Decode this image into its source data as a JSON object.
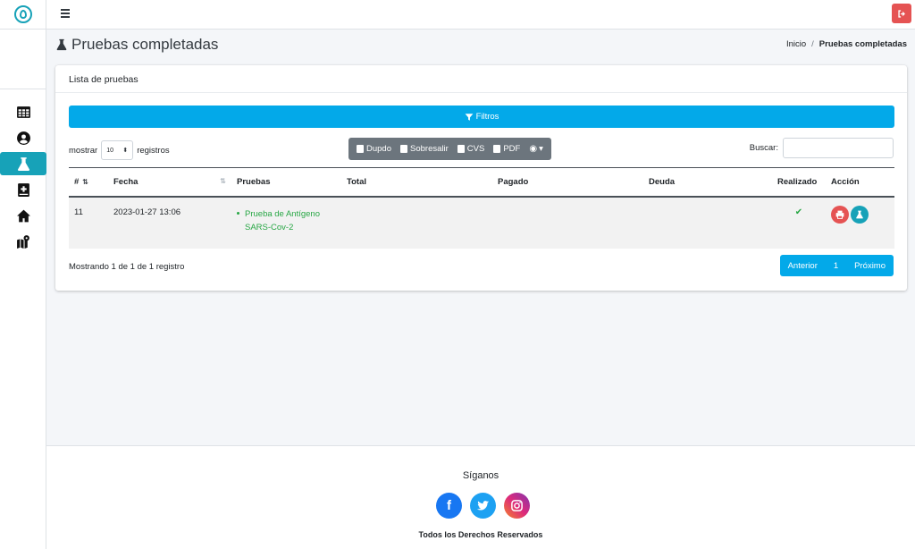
{
  "header": {
    "title": "Pruebas completadas",
    "breadcrumb": [
      "Inicio",
      "Pruebas completadas"
    ]
  },
  "card": {
    "title": "Lista de pruebas",
    "filter_label": "Filtros",
    "length_prefix": "mostrar",
    "length_value": "10",
    "length_suffix": "registros",
    "export_buttons": [
      "Dupdo",
      "Sobresalir",
      "CVS",
      "PDF"
    ],
    "search_label": "Buscar:",
    "search_value": ""
  },
  "table": {
    "columns": [
      "#",
      "Fecha",
      "Pruebas",
      "Total",
      "Pagado",
      "Deuda",
      "Realizado",
      "Acción"
    ],
    "rows": [
      {
        "id": "11",
        "fecha": "2023-01-27 13:06",
        "pruebas": "Prueba de Antígeno SARS-Cov-2",
        "total": "",
        "pagado": "",
        "deuda": ""
      }
    ]
  },
  "info": "Mostrando 1 de 1 de 1 registro",
  "pagination": {
    "prev": "Anterior",
    "page": "1",
    "next": "Próximo"
  },
  "footer": {
    "follow": "Síganos",
    "rights": "Todos los Derechos Reservados",
    "socials": [
      "facebook-icon",
      "twitter-icon",
      "instagram-icon"
    ]
  },
  "colors": {
    "accent": "#03a9e9",
    "sidebar_active": "#17a2b8",
    "danger": "#e55353",
    "success": "#28a745"
  }
}
